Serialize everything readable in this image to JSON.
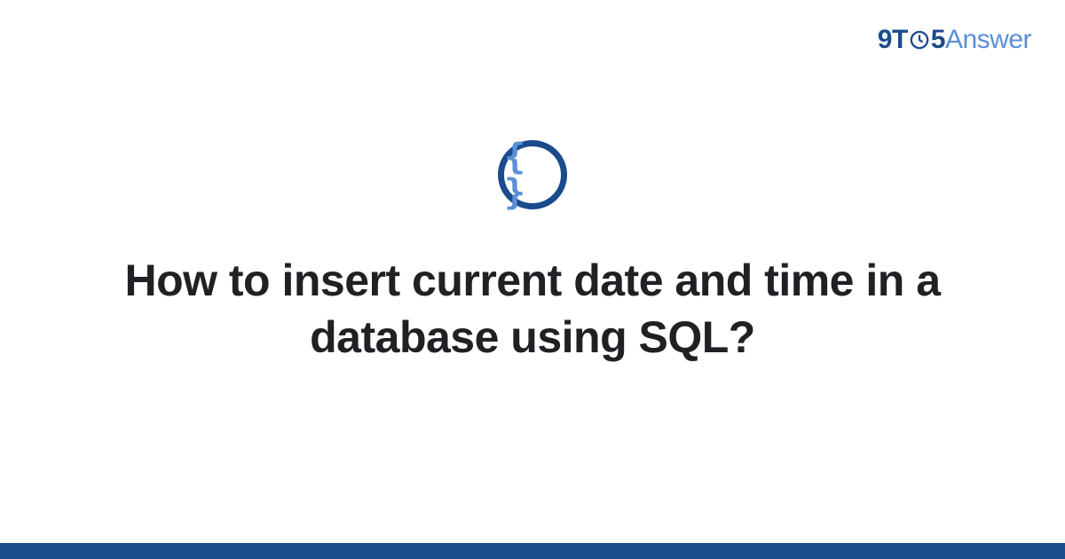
{
  "brand": {
    "part1": "9",
    "part2": "T",
    "part3": "5",
    "part4": "Answer"
  },
  "badge": {
    "icon_name": "code-braces-icon",
    "glyph": "{ }"
  },
  "title": "How to insert current date and time in a database using SQL?",
  "colors": {
    "primary": "#1a4b8c",
    "accent": "#5b8fd6",
    "text": "#202124"
  }
}
